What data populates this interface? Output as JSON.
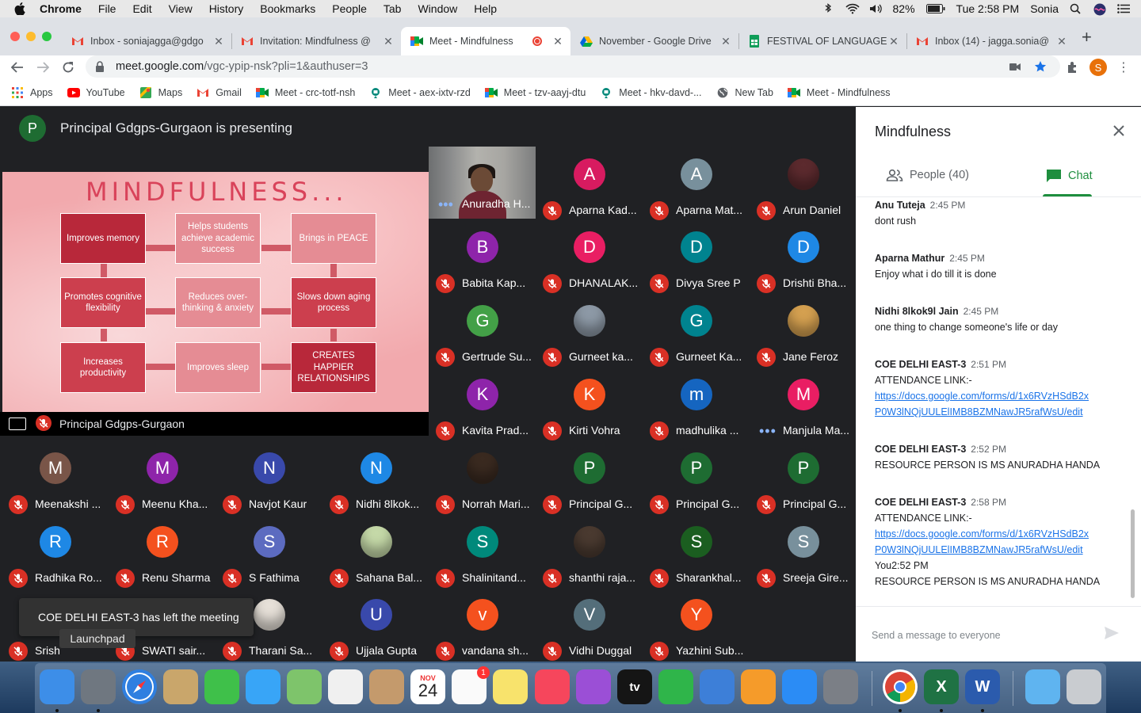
{
  "menubar": {
    "app": "Chrome",
    "items": [
      "File",
      "Edit",
      "View",
      "History",
      "Bookmarks",
      "People",
      "Tab",
      "Window",
      "Help"
    ],
    "battery": "82%",
    "clock": "Tue 2:58 PM",
    "user": "Sonia"
  },
  "tabs": [
    {
      "title": "Inbox - soniajagga@gdgo",
      "icon": "gmail-icon"
    },
    {
      "title": "Invitation: Mindfulness @",
      "icon": "gmail-icon"
    },
    {
      "title": "Meet - Mindfulness",
      "icon": "meet-icon",
      "active": true
    },
    {
      "title": "November - Google Drive",
      "icon": "drive-icon"
    },
    {
      "title": "FESTIVAL OF LANGUAGE",
      "icon": "sheets-icon"
    },
    {
      "title": "Inbox (14) - jagga.sonia@",
      "icon": "gmail-icon"
    }
  ],
  "omnibox": {
    "host": "meet.google.com",
    "path": "/vgc-ypip-nsk?pli=1&authuser=3"
  },
  "profile_initial": "S",
  "bookmarks": [
    {
      "label": "Apps",
      "icon": "apps-grid-icon"
    },
    {
      "label": "YouTube",
      "icon": "youtube-icon"
    },
    {
      "label": "Maps",
      "icon": "maps-icon"
    },
    {
      "label": "Gmail",
      "icon": "gmail-icon"
    },
    {
      "label": "Meet - crc-totf-nsh",
      "icon": "meet-icon"
    },
    {
      "label": "Meet - aex-ixtv-rzd",
      "icon": "meet-old-icon"
    },
    {
      "label": "Meet - tzv-aayj-dtu",
      "icon": "meet-icon"
    },
    {
      "label": "Meet - hkv-davd-...",
      "icon": "meet-old-icon"
    },
    {
      "label": "New Tab",
      "icon": "globe-icon"
    },
    {
      "label": "Meet - Mindfulness",
      "icon": "meet-icon"
    }
  ],
  "presenting": {
    "initial": "P",
    "text": "Principal Gdgps-Gurgaon is presenting",
    "label": "Principal Gdgps-Gurgaon"
  },
  "slide": {
    "title": "MINDFULNESS...",
    "boxes": [
      "Improves memory",
      "Helps students achieve academic success",
      "Brings in PEACE",
      "Promotes cognitive flexibility",
      "Reduces over-thinking & anxiety",
      "Slows down aging process",
      "Increases productivity",
      "Improves sleep",
      "CREATES HAPPIER RELATIONSHIPS"
    ]
  },
  "featured_participant": "Anuradha H...",
  "participants": [
    {
      "name": "Aparna Kad...",
      "initial": "A",
      "color": "#d81b60"
    },
    {
      "name": "Aparna Mat...",
      "initial": "A",
      "color": "#78909c"
    },
    {
      "name": "Arun Daniel",
      "initial": "",
      "color": "#5c2a2e",
      "photo": true
    },
    {
      "name": "Babita Kap...",
      "initial": "B",
      "color": "#8e24aa"
    },
    {
      "name": "DHANALAK...",
      "initial": "D",
      "color": "#e91e63"
    },
    {
      "name": "Divya Sree P",
      "initial": "D",
      "color": "#00838f"
    },
    {
      "name": "Drishti Bha...",
      "initial": "D",
      "color": "#1e88e5"
    },
    {
      "name": "Gertrude Su...",
      "initial": "G",
      "color": "#43a047"
    },
    {
      "name": "Gurneet ka...",
      "initial": "",
      "color": "#8d99a6",
      "photo": true
    },
    {
      "name": "Gurneet Ka...",
      "initial": "G",
      "color": "#00838f"
    },
    {
      "name": "Jane Feroz",
      "initial": "",
      "color": "#d4a050",
      "photo": true
    },
    {
      "name": "Kavita Prad...",
      "initial": "K",
      "color": "#8e24aa"
    },
    {
      "name": "Kirti Vohra",
      "initial": "K",
      "color": "#f4511e"
    },
    {
      "name": "madhulika ...",
      "initial": "m",
      "color": "#1565c0"
    },
    {
      "name": "Manjula Ma...",
      "initial": "M",
      "color": "#e91e63",
      "dots": true
    },
    {
      "name": "Meenakshi ...",
      "initial": "M",
      "color": "#795548"
    },
    {
      "name": "Meenu Kha...",
      "initial": "M",
      "color": "#8e24aa"
    },
    {
      "name": "Navjot Kaur",
      "initial": "N",
      "color": "#3949ab"
    },
    {
      "name": "Nidhi 8lkok...",
      "initial": "N",
      "color": "#1e88e5"
    },
    {
      "name": "Norrah Mari...",
      "initial": "",
      "color": "#3a2a20",
      "photo": true
    },
    {
      "name": "Principal G...",
      "initial": "P",
      "color": "#1e6c32"
    },
    {
      "name": "Principal G...",
      "initial": "P",
      "color": "#1e6c32"
    },
    {
      "name": "Principal G...",
      "initial": "P",
      "color": "#1e6c32"
    },
    {
      "name": "Radhika Ro...",
      "initial": "R",
      "color": "#1e88e5"
    },
    {
      "name": "Renu Sharma",
      "initial": "R",
      "color": "#f4511e"
    },
    {
      "name": "S Fathima",
      "initial": "S",
      "color": "#5c6bc0"
    },
    {
      "name": "Sahana Bal...",
      "initial": "",
      "color": "#c5d9a8",
      "photo": true
    },
    {
      "name": "Shalinitand...",
      "initial": "S",
      "color": "#00897b"
    },
    {
      "name": "shanthi raja...",
      "initial": "",
      "color": "#4a3a30",
      "photo": true
    },
    {
      "name": "Sharankhal...",
      "initial": "S",
      "color": "#1b5e20"
    },
    {
      "name": "Sreeja Gire...",
      "initial": "S",
      "color": "#78909c"
    },
    {
      "name": "Srish",
      "initial": "",
      "color": "#202124",
      "hidden_avatar": true
    },
    {
      "name": "SWATI sair...",
      "initial": "",
      "color": "#202124",
      "hidden_avatar": true
    },
    {
      "name": "Tharani Sa...",
      "initial": "",
      "color": "#e6e0d8",
      "photo": true
    },
    {
      "name": "Ujjala Gupta",
      "initial": "U",
      "color": "#3949ab"
    },
    {
      "name": "vandana sh...",
      "initial": "v",
      "color": "#f4511e"
    },
    {
      "name": "Vidhi Duggal",
      "initial": "V",
      "color": "#546e7a"
    },
    {
      "name": "Yazhini Sub...",
      "initial": "Y",
      "color": "#f4511e"
    }
  ],
  "toast": "COE DELHI EAST-3 has left the meeting",
  "dock_tooltip": "Launchpad",
  "panel": {
    "title": "Mindfulness",
    "people_tab": "People (40)",
    "chat_tab": "Chat",
    "composer_placeholder": "Send a message to everyone",
    "messages": [
      {
        "sender": "Anu Tuteja",
        "time": "2:45 PM",
        "lines": [
          "dont rush"
        ]
      },
      {
        "sender": "Aparna Mathur",
        "time": "2:45 PM",
        "lines": [
          "Enjoy what i do till it is done"
        ]
      },
      {
        "sender": "Nidhi 8lkok9l Jain",
        "time": "2:45 PM",
        "lines": [
          "one thing to change someone's life or day"
        ]
      },
      {
        "sender": "COE DELHI EAST-3",
        "time": "2:51 PM",
        "lines": [
          "ATTENDANCE LINK:-"
        ],
        "link": [
          "https://docs.google.com/forms/d/1x6RVzHSdB2x",
          "P0W3lNQjUULElIMB8BZMNawJR5rafWsU/edit"
        ]
      },
      {
        "sender": "COE DELHI EAST-3",
        "time": "2:52 PM",
        "lines": [
          "RESOURCE PERSON IS MS ANURADHA HANDA"
        ]
      },
      {
        "sender": "COE DELHI EAST-3",
        "time": "2:58 PM",
        "lines": [
          "ATTENDANCE LINK:-"
        ],
        "link": [
          "https://docs.google.com/forms/d/1x6RVzHSdB2x",
          "P0W3lNQjUULElIMB8BZMNawJR5rafWsU/edit"
        ],
        "after": [
          "You2:52 PM",
          "RESOURCE PERSON IS MS ANURADHA HANDA"
        ]
      }
    ]
  },
  "dock": [
    {
      "name": "finder-icon",
      "color": "#3d8ee8"
    },
    {
      "name": "launchpad-icon",
      "color": "#6f7780"
    },
    {
      "name": "safari-icon",
      "color": "#2f7fe0"
    },
    {
      "name": "mail-stamp-icon",
      "color": "#c9a66b"
    },
    {
      "name": "facetime-icon",
      "color": "#3fc04a"
    },
    {
      "name": "messages-icon",
      "color": "#38a5f7"
    },
    {
      "name": "maps-icon",
      "color": "#7ec46b"
    },
    {
      "name": "photos-icon",
      "color": "#f0f0f0"
    },
    {
      "name": "contacts-icon",
      "color": "#c49a6c"
    },
    {
      "name": "calendar-icon",
      "color": "#ffffff",
      "text": "24",
      "subtext": "NOV"
    },
    {
      "name": "reminders-icon",
      "color": "#fafafa",
      "badge": "1"
    },
    {
      "name": "notes-icon",
      "color": "#f8e36c"
    },
    {
      "name": "music-icon",
      "color": "#f6465c"
    },
    {
      "name": "podcasts-icon",
      "color": "#9b4fd6"
    },
    {
      "name": "apple-tv-icon",
      "color": "#151515",
      "text": "tv"
    },
    {
      "name": "numbers-icon",
      "color": "#2fb54a"
    },
    {
      "name": "keynote-icon",
      "color": "#3d7fd8"
    },
    {
      "name": "pages-icon",
      "color": "#f59b2a"
    },
    {
      "name": "app-store-icon",
      "color": "#2b8cf5"
    },
    {
      "name": "system-preferences-icon",
      "color": "#7b7f86"
    },
    {
      "name": "chrome-icon",
      "color": "#ffffff"
    },
    {
      "name": "excel-icon",
      "color": "#1f7244",
      "text": "X"
    },
    {
      "name": "word-icon",
      "color": "#2b5bad",
      "text": "W"
    },
    {
      "name": "downloads-folder-icon",
      "color": "#5fb4f0"
    },
    {
      "name": "trash-icon",
      "color": "#c9ccd0"
    }
  ]
}
